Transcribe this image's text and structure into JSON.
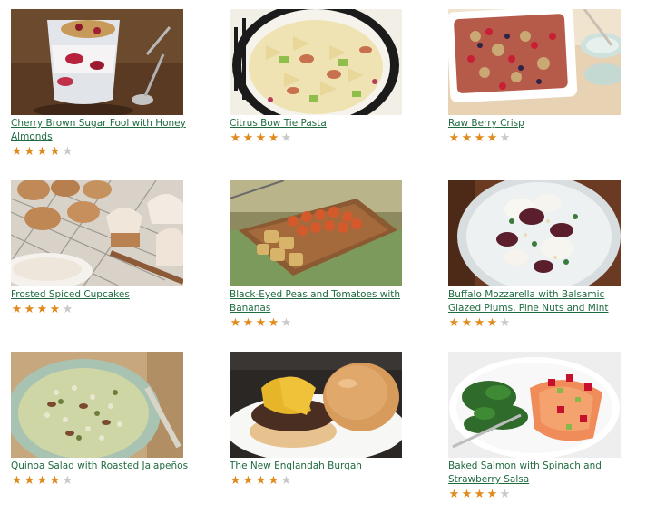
{
  "colors": {
    "link": "#1f6b3f",
    "star_filled": "#e08a1e",
    "star_empty": "#c9c9c9"
  },
  "recipes": [
    {
      "title": "Cherry Brown Sugar Fool with Honey Almonds",
      "rating": 4,
      "max_rating": 5,
      "image_icon": "parfait-glass-image"
    },
    {
      "title": "Citrus Bow Tie Pasta",
      "rating": 4,
      "max_rating": 5,
      "image_icon": "pasta-bowl-image"
    },
    {
      "title": "Raw Berry Crisp",
      "rating": 4,
      "max_rating": 5,
      "image_icon": "berry-crisp-dish-image"
    },
    {
      "title": "Frosted Spiced Cupcakes",
      "rating": 4,
      "max_rating": 5,
      "image_icon": "cupcakes-rack-image"
    },
    {
      "title": "Black-Eyed Peas and Tomatoes with Bananas",
      "rating": 4,
      "max_rating": 5,
      "image_icon": "peas-platter-image"
    },
    {
      "title": "Buffalo Mozzarella with Balsamic Glazed Plums, Pine Nuts and Mint",
      "rating": 4,
      "max_rating": 5,
      "image_icon": "mozzarella-plate-image"
    },
    {
      "title": "Quinoa Salad with Roasted Jalapeños",
      "rating": 4,
      "max_rating": 5,
      "image_icon": "quinoa-bowl-image"
    },
    {
      "title": "The New Englandah Burgah",
      "rating": 4,
      "max_rating": 5,
      "image_icon": "burger-image"
    },
    {
      "title": "Baked Salmon with Spinach and Strawberry Salsa",
      "rating": 4,
      "max_rating": 5,
      "image_icon": "salmon-plate-image"
    }
  ]
}
